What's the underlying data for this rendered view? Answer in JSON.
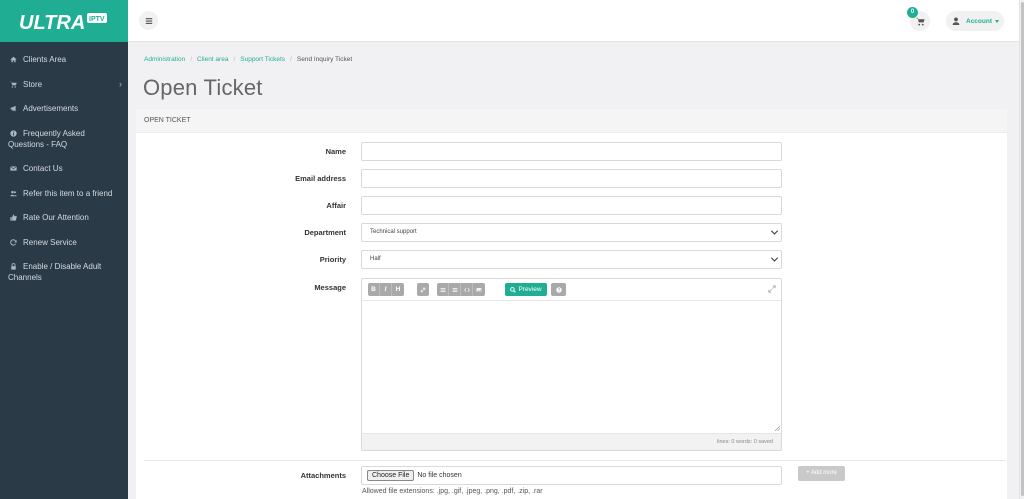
{
  "brand": {
    "logo_text": "ULTRA",
    "logo_badge": "IPTV"
  },
  "sidebar": {
    "items": [
      {
        "label": "Clients Area",
        "icon": "home-icon"
      },
      {
        "label": "Store",
        "icon": "shopping-cart-icon",
        "has_submenu": true
      },
      {
        "label": "Advertisements",
        "icon": "bullhorn-icon"
      },
      {
        "label": "Frequently Asked Questions - FAQ",
        "icon": "info-icon"
      },
      {
        "label": "Contact Us",
        "icon": "envelope-icon"
      },
      {
        "label": "Refer this item to a friend",
        "icon": "users-icon"
      },
      {
        "label": "Rate Our Attention",
        "icon": "thumbs-up-icon"
      },
      {
        "label": "Renew Service",
        "icon": "refresh-icon"
      },
      {
        "label": "Enable / Disable Adult Channels",
        "icon": "lock-icon"
      }
    ]
  },
  "topbar": {
    "cart_count": "0",
    "account_label": "Account"
  },
  "breadcrumb": {
    "items": [
      "Administration",
      "Client area",
      "Support Tickets"
    ],
    "current": "Send Inquiry Ticket"
  },
  "page": {
    "title": "Open Ticket",
    "panel_title": "Open Ticket"
  },
  "form": {
    "name_label": "Name",
    "name_value": "",
    "email_label": "Email address",
    "email_value": "",
    "affair_label": "Affair",
    "affair_value": "",
    "department_label": "Department",
    "department_value": "Technical support",
    "priority_label": "Priority",
    "priority_value": "Half",
    "message_label": "Message",
    "editor": {
      "bold": "B",
      "italic": "I",
      "heading": "H",
      "preview_label": "Preview",
      "status": "lines: 0 words: 0    saved"
    },
    "attachments_label": "Attachments",
    "choose_file_label": "Choose File",
    "no_file_text": "No file chosen",
    "add_more_label": "+ Add more",
    "allowed_extensions": "Allowed file extensions: .jpg, .gif, .jpeg, .png, .pdf, .zip, .rar"
  },
  "colors": {
    "accent": "#1fae93",
    "sidebar_bg": "#2b3a47"
  }
}
